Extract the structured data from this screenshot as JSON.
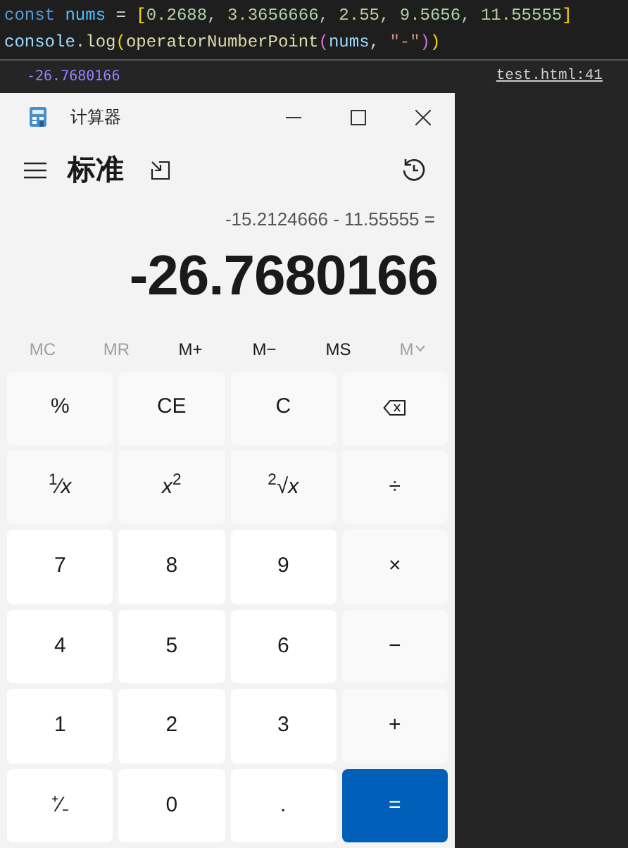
{
  "code_lines": [
    {
      "tokens": [
        {
          "text": "const",
          "color": "#569cd6"
        },
        {
          "text": " nums",
          "color": "#4fc1ff"
        },
        {
          "text": " = ",
          "color": "#d4d4d4"
        },
        {
          "text": "[",
          "color": "#ffd700"
        },
        {
          "text": "0.2688, 3.3656666, 2.55, 9.5656, 11.55555",
          "color": "#b5cea8"
        },
        {
          "text": "]",
          "color": "#ffd700"
        }
      ]
    },
    {
      "tokens": [
        {
          "text": "console",
          "color": "#9cdcfe"
        },
        {
          "text": ".",
          "color": "#d4d4d4"
        },
        {
          "text": "log",
          "color": "#dcdcaa"
        },
        {
          "text": "(",
          "color": "#ffd700"
        },
        {
          "text": "operatorNumberPoint",
          "color": "#dcdcaa"
        },
        {
          "text": "(",
          "color": "#da70d6"
        },
        {
          "text": "nums",
          "color": "#9cdcfe"
        },
        {
          "text": ", ",
          "color": "#d4d4d4"
        },
        {
          "text": "\"-\"",
          "color": "#ce9178"
        },
        {
          "text": ")",
          "color": "#da70d6"
        },
        {
          "text": ")",
          "color": "#ffd700"
        }
      ]
    }
  ],
  "console": {
    "output": "-26.7680166",
    "source_link": "test.html:41"
  },
  "calculator": {
    "title": "计算器",
    "mode": "标准",
    "expression": "-15.2124666 - 11.55555 =",
    "result": "-26.7680166",
    "memory": [
      {
        "label": "MC",
        "disabled": true
      },
      {
        "label": "MR",
        "disabled": true
      },
      {
        "label": "M+",
        "disabled": false
      },
      {
        "label": "M−",
        "disabled": false
      },
      {
        "label": "MS",
        "disabled": false
      },
      {
        "label": "M",
        "disabled": true
      }
    ],
    "keys": [
      {
        "kind": "function",
        "label": "%"
      },
      {
        "kind": "function",
        "label": "CE"
      },
      {
        "kind": "function",
        "label": "C"
      },
      {
        "kind": "backspace"
      },
      {
        "kind": "function",
        "label": "$^{1}$⁄*x*"
      },
      {
        "kind": "function",
        "label": "*x*$^{2}$"
      },
      {
        "kind": "function",
        "label": "$^{2}$√*x*"
      },
      {
        "kind": "function",
        "label": "÷"
      },
      {
        "kind": "number",
        "label": "7"
      },
      {
        "kind": "number",
        "label": "8"
      },
      {
        "kind": "number",
        "label": "9"
      },
      {
        "kind": "function",
        "label": "×"
      },
      {
        "kind": "number",
        "label": "4"
      },
      {
        "kind": "number",
        "label": "5"
      },
      {
        "kind": "number",
        "label": "6"
      },
      {
        "kind": "function",
        "label": "−"
      },
      {
        "kind": "number",
        "label": "1"
      },
      {
        "kind": "number",
        "label": "2"
      },
      {
        "kind": "number",
        "label": "3"
      },
      {
        "kind": "function",
        "label": "+"
      },
      {
        "kind": "number",
        "label": "⁺⁄₋"
      },
      {
        "kind": "number",
        "label": "0"
      },
      {
        "kind": "number",
        "label": "."
      },
      {
        "kind": "equals",
        "label": "="
      }
    ]
  }
}
